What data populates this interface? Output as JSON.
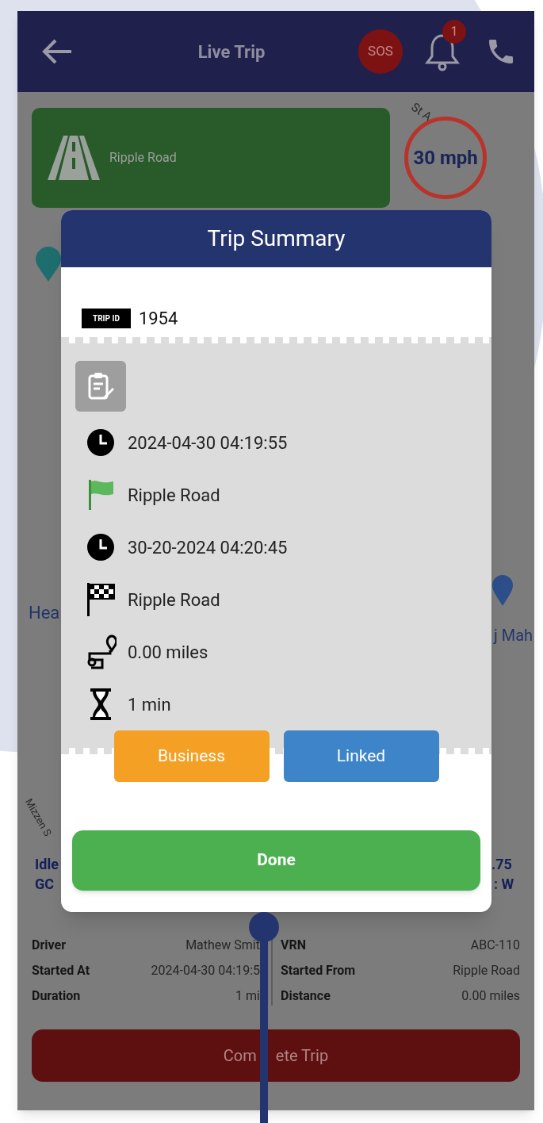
{
  "header": {
    "title": "Live Trip",
    "sos": "SOS",
    "notification_count": "1"
  },
  "road_card": {
    "road": "Ripple Road"
  },
  "speed_limit": "30 mph",
  "map_labels": [
    "St A",
    "Hea",
    "j Mah",
    "Mizzen S",
    "Idle",
    ".75",
    "GC",
    ": W"
  ],
  "trip_summary": {
    "title": "Trip Summary",
    "trip_id_label": "TRIP ID",
    "trip_id": "1954",
    "details": [
      {
        "kind": "time",
        "text": "2024-04-30 04:19:55"
      },
      {
        "kind": "start",
        "text": "Ripple Road"
      },
      {
        "kind": "time",
        "text": "30-20-2024 04:20:45"
      },
      {
        "kind": "finish",
        "text": "Ripple Road"
      },
      {
        "kind": "distance",
        "text": "0.00 miles"
      },
      {
        "kind": "duration",
        "text": "1 min"
      }
    ],
    "tags": [
      {
        "label": "Business",
        "color": "#f4a025"
      },
      {
        "label": "Linked",
        "color": "#3d85c8"
      }
    ],
    "done": "Done"
  },
  "trip_info": {
    "left": [
      {
        "label": "Driver",
        "value": "Mathew Smit"
      },
      {
        "label": "Started At",
        "value": "2024-04-30 04:19:5"
      },
      {
        "label": "Duration",
        "value": "1 mi"
      }
    ],
    "right": [
      {
        "label": "VRN",
        "value": "ABC-110"
      },
      {
        "label": "Started From",
        "value": "Ripple Road"
      },
      {
        "label": "Distance",
        "value": "0.00 miles"
      }
    ]
  },
  "complete_button": {
    "label_parts": [
      "Com",
      "ete Trip"
    ]
  }
}
